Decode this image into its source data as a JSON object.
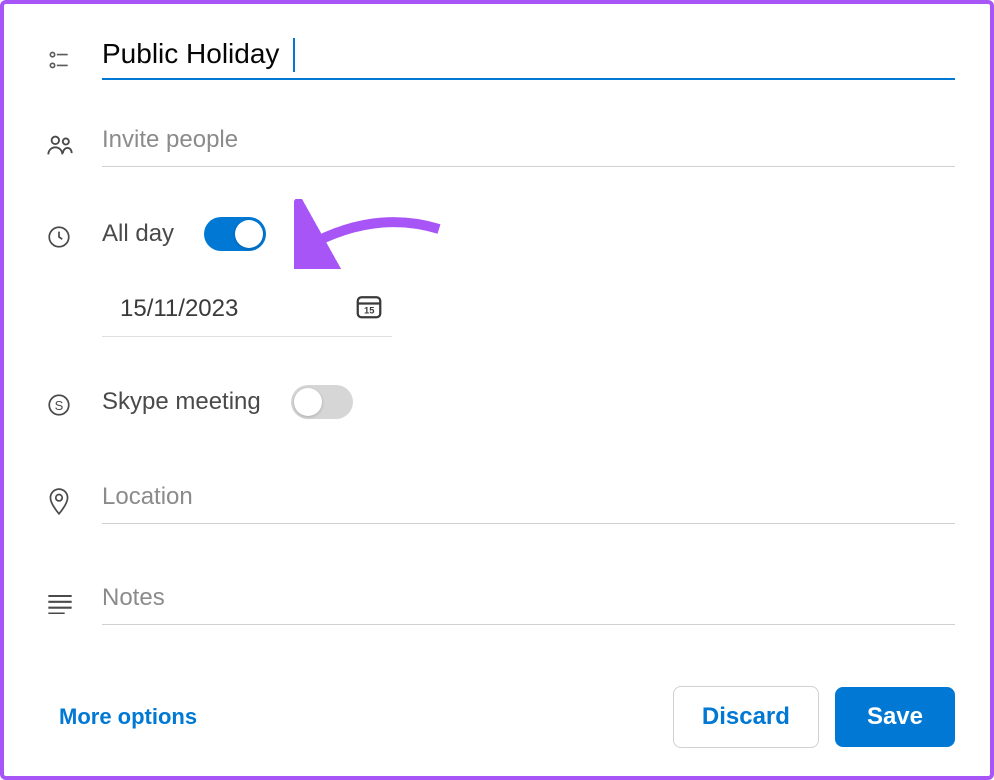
{
  "event": {
    "title": "Public Holiday",
    "invite_placeholder": "Invite people",
    "all_day_label": "All day",
    "all_day_on": true,
    "date": "15/11/2023",
    "date_day": "15",
    "skype_label": "Skype meeting",
    "skype_on": false,
    "location_placeholder": "Location",
    "notes_placeholder": "Notes"
  },
  "footer": {
    "more_options": "More options",
    "discard": "Discard",
    "save": "Save"
  },
  "colors": {
    "accent": "#0078d4",
    "annotation": "#a855f7"
  }
}
